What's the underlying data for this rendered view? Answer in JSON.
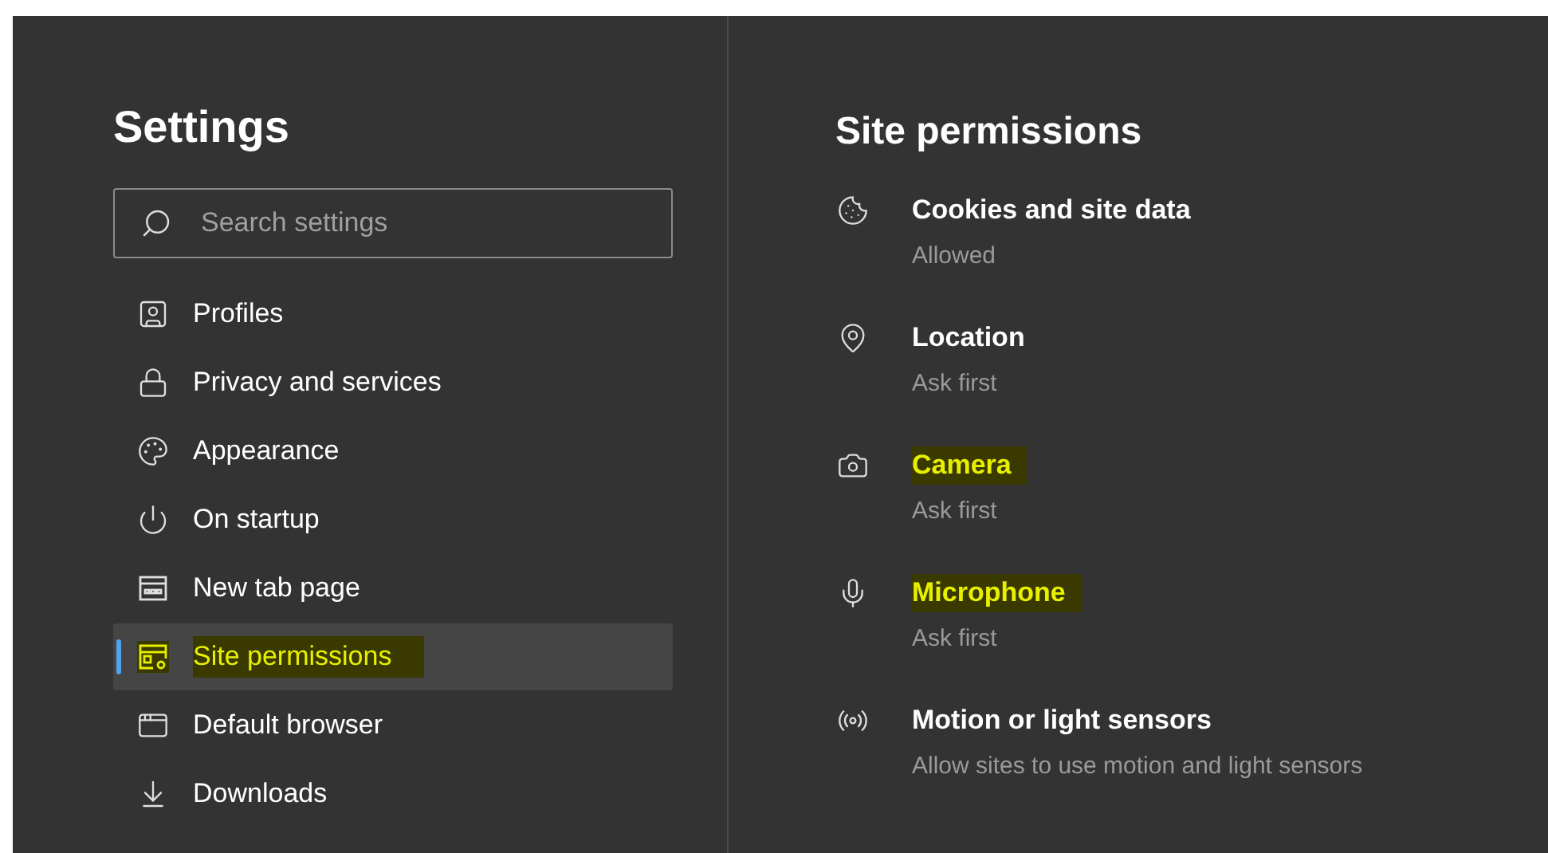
{
  "sidebar": {
    "title": "Settings",
    "search": {
      "placeholder": "Search settings"
    },
    "items": [
      {
        "label": "Profiles",
        "selected": false,
        "highlighted": false
      },
      {
        "label": "Privacy and services",
        "selected": false,
        "highlighted": false
      },
      {
        "label": "Appearance",
        "selected": false,
        "highlighted": false
      },
      {
        "label": "On startup",
        "selected": false,
        "highlighted": false
      },
      {
        "label": "New tab page",
        "selected": false,
        "highlighted": false
      },
      {
        "label": "Site permissions",
        "selected": true,
        "highlighted": true
      },
      {
        "label": "Default browser",
        "selected": false,
        "highlighted": false
      },
      {
        "label": "Downloads",
        "selected": false,
        "highlighted": false
      }
    ]
  },
  "content": {
    "title": "Site permissions",
    "permissions": [
      {
        "name": "Cookies and site data",
        "status": "Allowed",
        "highlighted": false
      },
      {
        "name": "Location",
        "status": "Ask first",
        "highlighted": false
      },
      {
        "name": "Camera",
        "status": "Ask first",
        "highlighted": true
      },
      {
        "name": "Microphone",
        "status": "Ask first",
        "highlighted": true
      },
      {
        "name": "Motion or light sensors",
        "status": "Allow sites to use motion and light sensors",
        "highlighted": false
      }
    ]
  }
}
